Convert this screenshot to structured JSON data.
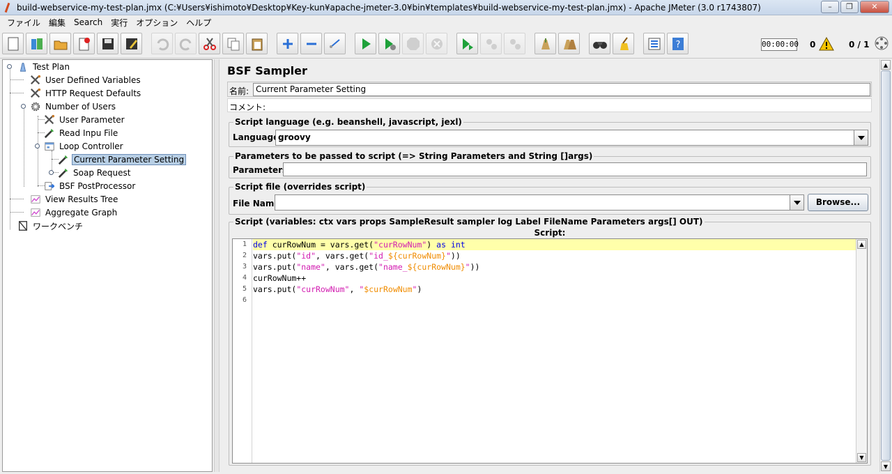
{
  "window": {
    "title": "build-webservice-my-test-plan.jmx (C:¥Users¥ishimoto¥Desktop¥Key-kun¥apache-jmeter-3.0¥bin¥templates¥build-webservice-my-test-plan.jmx) - Apache JMeter (3.0 r1743807)",
    "minimize": "–",
    "maximize": "❐",
    "close": "✕"
  },
  "menu": [
    "ファイル",
    "編集",
    "Search",
    "実行",
    "オプション",
    "ヘルプ"
  ],
  "toolbar": {
    "timer": "00:00:00",
    "warning_count": "0",
    "threads": "0 / 1",
    "buttons": [
      "new-icon",
      "templates-icon",
      "open-icon",
      "close-plan-icon",
      "save-icon",
      "save-as-icon",
      "undo-icon",
      "redo-icon",
      "cut-icon",
      "copy-icon",
      "paste-icon",
      "expand-icon",
      "collapse-icon",
      "toggle-icon",
      "start-icon",
      "start-no-pauses-icon",
      "stop-icon",
      "shutdown-icon",
      "remote-start-icon",
      "remote-stop-icon",
      "remote-shutdown-icon",
      "clear-icon",
      "clear-all-icon",
      "search-icon",
      "reset-search-icon",
      "function-helper-icon",
      "help-icon"
    ]
  },
  "tree": {
    "items": [
      {
        "label": "Test Plan",
        "icon": "test-plan-icon"
      },
      {
        "label": "User Defined Variables",
        "icon": "config-icon"
      },
      {
        "label": "HTTP Request Defaults",
        "icon": "config-icon"
      },
      {
        "label": "Number of Users",
        "icon": "thread-group-icon"
      },
      {
        "label": "User Parameter",
        "icon": "config-icon"
      },
      {
        "label": "Read Inpu File",
        "icon": "sampler-icon"
      },
      {
        "label": "Loop Controller",
        "icon": "controller-icon"
      },
      {
        "label": "Current Parameter Setting",
        "icon": "sampler-icon"
      },
      {
        "label": "Soap Request",
        "icon": "sampler-icon"
      },
      {
        "label": "BSF PostProcessor",
        "icon": "postprocessor-icon"
      },
      {
        "label": "View Results Tree",
        "icon": "listener-icon"
      },
      {
        "label": "Aggregate Graph",
        "icon": "listener-icon"
      },
      {
        "label": "ワークベンチ",
        "icon": "workbench-icon"
      }
    ]
  },
  "sampler": {
    "title": "BSF Sampler",
    "name_label": "名前:",
    "name_value": "Current Parameter Setting",
    "comment_label": "コメント:",
    "language_group": "Script language (e.g. beanshell, javascript, jexl)",
    "language_label": "Language:",
    "language_value": "groovy",
    "params_group": "Parameters to be passed to script (=> String Parameters and String []args)",
    "params_label": "Parameters:",
    "params_value": "",
    "file_group": "Script file (overrides script)",
    "file_label": "File Name:",
    "file_value": "",
    "browse_label": "Browse...",
    "script_group": "Script (variables: ctx vars props SampleResult sampler log Label FileName Parameters args[] OUT)",
    "script_caption": "Script:",
    "line_numbers": [
      "1",
      "2",
      "3",
      "4",
      "5",
      "6"
    ],
    "code": {
      "l1_kw1": "def",
      "l1_a": " curRowNum = vars.get(",
      "l1_str": "\"curRowNum\"",
      "l1_b": ") ",
      "l1_kw2": "as",
      "l1_c": " ",
      "l1_kw3": "int",
      "l2_a": "vars.put(",
      "l2_str1": "\"id\"",
      "l2_b": ", vars.get(",
      "l2_str2": "\"id_",
      "l2_interp": "${curRowNum}",
      "l2_str3": "\"",
      "l2_c": "))",
      "l3_a": "vars.put(",
      "l3_str1": "\"name\"",
      "l3_b": ", vars.get(",
      "l3_str2": "\"name_",
      "l3_interp": "${curRowNum}",
      "l3_str3": "\"",
      "l3_c": "))",
      "l4": "curRowNum++",
      "l5_a": "vars.put(",
      "l5_str1": "\"curRowNum\"",
      "l5_b": ", ",
      "l5_str2": "\"",
      "l5_interp": "$curRowNum",
      "l5_str3": "\"",
      "l5_c": ")",
      "l6": ""
    }
  }
}
